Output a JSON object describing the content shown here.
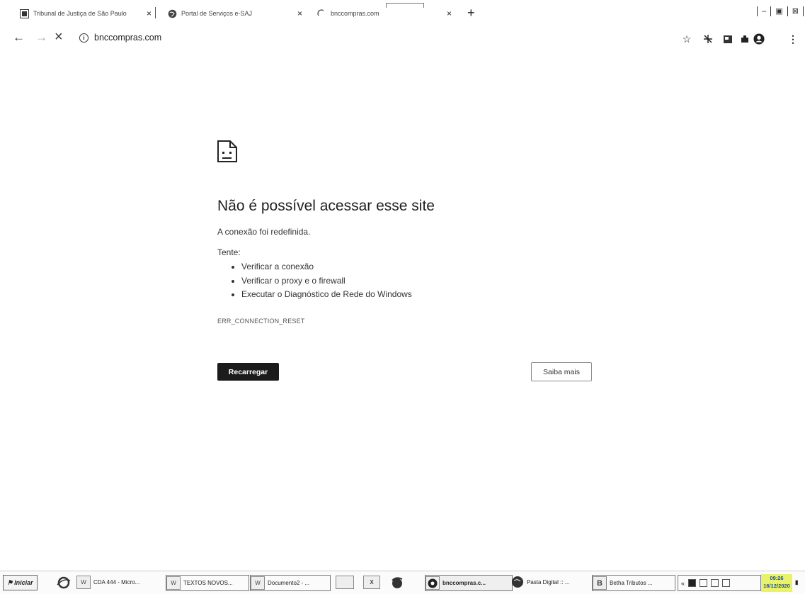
{
  "browser": {
    "tabs": [
      {
        "title": "Tribunal de Justiça de São Paulo",
        "icon": "court-seal-icon"
      },
      {
        "title": "Portal de Serviços e-SAJ",
        "icon": "globe-icon"
      },
      {
        "title": "bnccompras.com",
        "icon": "loading-spinner-icon"
      }
    ],
    "new_tab_label": "+",
    "close_glyph": "×",
    "window_controls": [
      "–",
      "▣",
      "⊠"
    ],
    "address": {
      "url": "bnccompras.com",
      "info_glyph": "i"
    },
    "nav": {
      "back": "←",
      "forward": "→",
      "stop": "×"
    },
    "toolbar_icons": [
      "star-icon",
      "extension-icon",
      "cast-icon",
      "puzzle-icon",
      "profile-icon",
      "menu-icon"
    ]
  },
  "error_page": {
    "icon": "sad-page-icon",
    "title": "Não é possível acessar esse site",
    "description": "A conexão foi redefinida.",
    "try_label": "Tente:",
    "suggestions": [
      "Verificar a conexão",
      "Verificar o proxy e o firewall",
      "Executar o Diagnóstico de Rede do Windows"
    ],
    "error_code": "ERR_CONNECTION_RESET",
    "reload_button": "Recarregar",
    "more_button": "Saiba mais"
  },
  "taskbar": {
    "start_label": "Iniciar",
    "items": [
      {
        "label": "CDA 444 - Micro...",
        "icon": "word-document-icon"
      },
      {
        "label": "TEXTOS NOVOS...",
        "icon": "word-document-icon"
      },
      {
        "label": "Documento2 - ...",
        "icon": "word-document-icon"
      },
      {
        "label": "bnccompras.c...",
        "icon": "chrome-icon"
      },
      {
        "label": "Pasta Digital :: ...",
        "icon": "globe-icon"
      },
      {
        "label": "Betha Tributos ...",
        "icon": "betha-icon"
      }
    ],
    "clock": {
      "time": "09:26",
      "date": "16/12/2020"
    }
  },
  "colors": {
    "reload_bg": "#1b1b1b",
    "clock_bg": "#e9f26a"
  }
}
